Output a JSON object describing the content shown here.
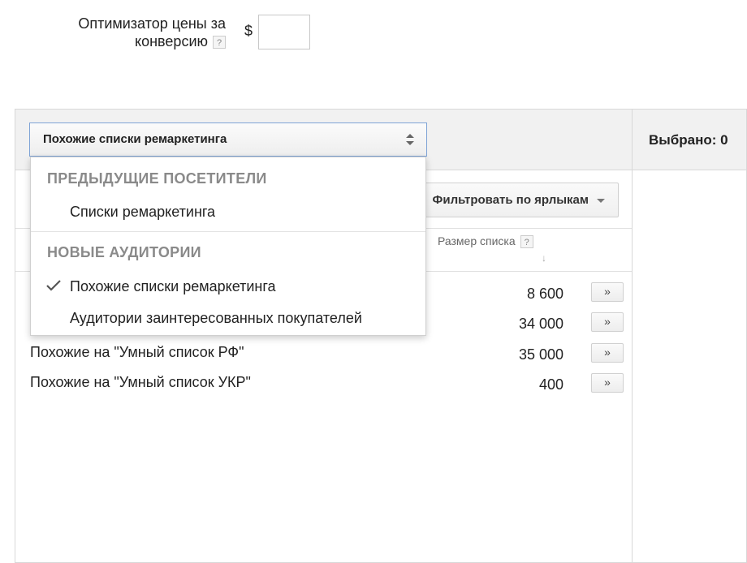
{
  "cpa": {
    "label_line1": "Оптимизатор цены за",
    "label_line2": "конверсию",
    "help": "?",
    "currency": "$",
    "value": ""
  },
  "audience_selector": {
    "selected": "Похожие списки ремаркетинга",
    "groups": [
      {
        "header": "ПРЕДЫДУЩИЕ ПОСЕТИТЕЛИ",
        "items": [
          {
            "label": "Списки ремаркетинга",
            "checked": false
          }
        ]
      },
      {
        "header": "НОВЫЕ АУДИТОРИИ",
        "items": [
          {
            "label": "Похожие списки ремаркетинга",
            "checked": true
          },
          {
            "label": "Аудитории заинтересованных покупателей",
            "checked": false
          }
        ]
      }
    ]
  },
  "selected_panel": {
    "label": "Выбрано: 0"
  },
  "filter": {
    "label": "Фильтровать по ярлыкам"
  },
  "table": {
    "size_header": "Размер списка",
    "help": "?",
    "rows": [
      {
        "name": "",
        "size": "8 600",
        "add": "»"
      },
      {
        "name": "",
        "size": "34 000",
        "add": "»"
      },
      {
        "name": "Похожие на \"Умный список РФ\"",
        "size": "35 000",
        "add": "»"
      },
      {
        "name": "Похожие на \"Умный список УКР\"",
        "size": "400",
        "add": "»"
      }
    ]
  },
  "colors": {
    "accent_border": "#7ea3d6",
    "group_header": "#8a8a8a",
    "panel_bg": "#f1f1f1"
  }
}
